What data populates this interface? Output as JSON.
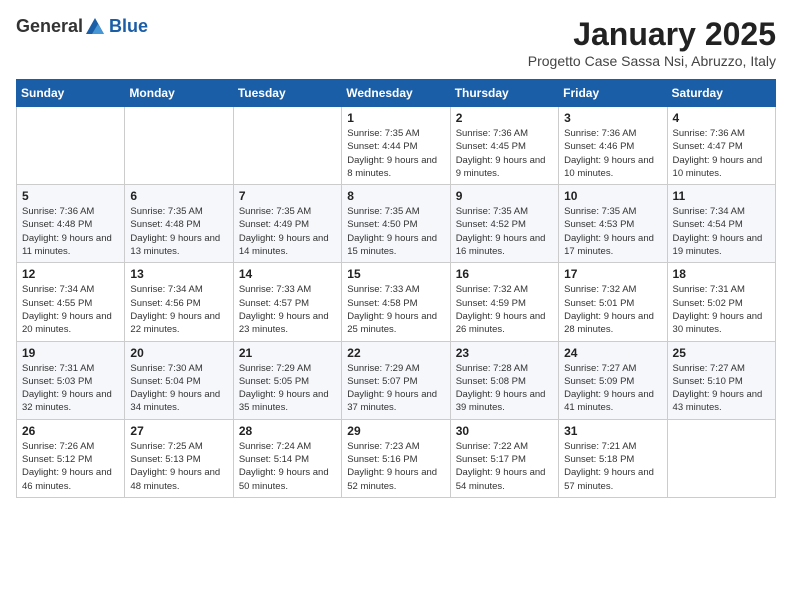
{
  "logo": {
    "line1": "General",
    "line2": "Blue"
  },
  "header": {
    "month": "January 2025",
    "subtitle": "Progetto Case Sassa Nsi, Abruzzo, Italy"
  },
  "weekdays": [
    "Sunday",
    "Monday",
    "Tuesday",
    "Wednesday",
    "Thursday",
    "Friday",
    "Saturday"
  ],
  "weeks": [
    [
      {
        "day": "",
        "info": ""
      },
      {
        "day": "",
        "info": ""
      },
      {
        "day": "",
        "info": ""
      },
      {
        "day": "1",
        "info": "Sunrise: 7:35 AM\nSunset: 4:44 PM\nDaylight: 9 hours and 8 minutes."
      },
      {
        "day": "2",
        "info": "Sunrise: 7:36 AM\nSunset: 4:45 PM\nDaylight: 9 hours and 9 minutes."
      },
      {
        "day": "3",
        "info": "Sunrise: 7:36 AM\nSunset: 4:46 PM\nDaylight: 9 hours and 10 minutes."
      },
      {
        "day": "4",
        "info": "Sunrise: 7:36 AM\nSunset: 4:47 PM\nDaylight: 9 hours and 10 minutes."
      }
    ],
    [
      {
        "day": "5",
        "info": "Sunrise: 7:36 AM\nSunset: 4:48 PM\nDaylight: 9 hours and 11 minutes."
      },
      {
        "day": "6",
        "info": "Sunrise: 7:35 AM\nSunset: 4:48 PM\nDaylight: 9 hours and 13 minutes."
      },
      {
        "day": "7",
        "info": "Sunrise: 7:35 AM\nSunset: 4:49 PM\nDaylight: 9 hours and 14 minutes."
      },
      {
        "day": "8",
        "info": "Sunrise: 7:35 AM\nSunset: 4:50 PM\nDaylight: 9 hours and 15 minutes."
      },
      {
        "day": "9",
        "info": "Sunrise: 7:35 AM\nSunset: 4:52 PM\nDaylight: 9 hours and 16 minutes."
      },
      {
        "day": "10",
        "info": "Sunrise: 7:35 AM\nSunset: 4:53 PM\nDaylight: 9 hours and 17 minutes."
      },
      {
        "day": "11",
        "info": "Sunrise: 7:34 AM\nSunset: 4:54 PM\nDaylight: 9 hours and 19 minutes."
      }
    ],
    [
      {
        "day": "12",
        "info": "Sunrise: 7:34 AM\nSunset: 4:55 PM\nDaylight: 9 hours and 20 minutes."
      },
      {
        "day": "13",
        "info": "Sunrise: 7:34 AM\nSunset: 4:56 PM\nDaylight: 9 hours and 22 minutes."
      },
      {
        "day": "14",
        "info": "Sunrise: 7:33 AM\nSunset: 4:57 PM\nDaylight: 9 hours and 23 minutes."
      },
      {
        "day": "15",
        "info": "Sunrise: 7:33 AM\nSunset: 4:58 PM\nDaylight: 9 hours and 25 minutes."
      },
      {
        "day": "16",
        "info": "Sunrise: 7:32 AM\nSunset: 4:59 PM\nDaylight: 9 hours and 26 minutes."
      },
      {
        "day": "17",
        "info": "Sunrise: 7:32 AM\nSunset: 5:01 PM\nDaylight: 9 hours and 28 minutes."
      },
      {
        "day": "18",
        "info": "Sunrise: 7:31 AM\nSunset: 5:02 PM\nDaylight: 9 hours and 30 minutes."
      }
    ],
    [
      {
        "day": "19",
        "info": "Sunrise: 7:31 AM\nSunset: 5:03 PM\nDaylight: 9 hours and 32 minutes."
      },
      {
        "day": "20",
        "info": "Sunrise: 7:30 AM\nSunset: 5:04 PM\nDaylight: 9 hours and 34 minutes."
      },
      {
        "day": "21",
        "info": "Sunrise: 7:29 AM\nSunset: 5:05 PM\nDaylight: 9 hours and 35 minutes."
      },
      {
        "day": "22",
        "info": "Sunrise: 7:29 AM\nSunset: 5:07 PM\nDaylight: 9 hours and 37 minutes."
      },
      {
        "day": "23",
        "info": "Sunrise: 7:28 AM\nSunset: 5:08 PM\nDaylight: 9 hours and 39 minutes."
      },
      {
        "day": "24",
        "info": "Sunrise: 7:27 AM\nSunset: 5:09 PM\nDaylight: 9 hours and 41 minutes."
      },
      {
        "day": "25",
        "info": "Sunrise: 7:27 AM\nSunset: 5:10 PM\nDaylight: 9 hours and 43 minutes."
      }
    ],
    [
      {
        "day": "26",
        "info": "Sunrise: 7:26 AM\nSunset: 5:12 PM\nDaylight: 9 hours and 46 minutes."
      },
      {
        "day": "27",
        "info": "Sunrise: 7:25 AM\nSunset: 5:13 PM\nDaylight: 9 hours and 48 minutes."
      },
      {
        "day": "28",
        "info": "Sunrise: 7:24 AM\nSunset: 5:14 PM\nDaylight: 9 hours and 50 minutes."
      },
      {
        "day": "29",
        "info": "Sunrise: 7:23 AM\nSunset: 5:16 PM\nDaylight: 9 hours and 52 minutes."
      },
      {
        "day": "30",
        "info": "Sunrise: 7:22 AM\nSunset: 5:17 PM\nDaylight: 9 hours and 54 minutes."
      },
      {
        "day": "31",
        "info": "Sunrise: 7:21 AM\nSunset: 5:18 PM\nDaylight: 9 hours and 57 minutes."
      },
      {
        "day": "",
        "info": ""
      }
    ]
  ]
}
